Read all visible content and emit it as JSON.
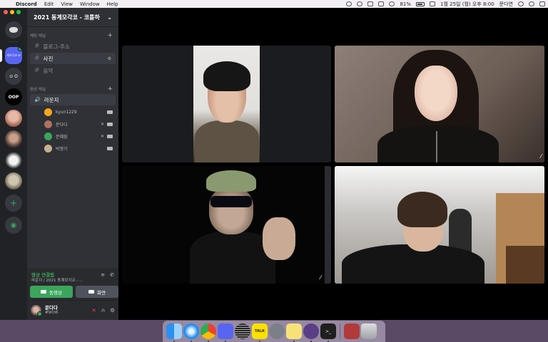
{
  "menubar": {
    "app_name": "Discord",
    "menus": [
      "Edit",
      "View",
      "Window",
      "Help"
    ],
    "battery": "81%",
    "datetime": "1월 25일 (월) 오후 8:00",
    "user": "문다연"
  },
  "guilds": {
    "active_label": "게모각코 코",
    "oop_label": "OOP",
    "double_o": "⊙ O"
  },
  "server": {
    "name": "2021 동계모각코 - 코틀하",
    "text_category": "채팅 채널",
    "voice_category": "음성 채널",
    "text_channels": [
      {
        "name": "블로그-주소",
        "selected": false
      },
      {
        "name": "사진",
        "selected": true
      },
      {
        "name": "음악",
        "selected": false
      }
    ],
    "voice_channel": "라운지",
    "voice_users": [
      {
        "name": "kyun1229",
        "color": "#faa61a"
      },
      {
        "name": "문다다",
        "color": "#b07060"
      },
      {
        "name": "문혜림",
        "color": "#3ba55c"
      },
      {
        "name": "박형기",
        "color": "#c8b090"
      }
    ]
  },
  "voice_panel": {
    "status": "영상 연결됨",
    "sub": "라운지 / 2021 동계모각코 - ...",
    "video_btn": "동영상",
    "screen_btn": "화면"
  },
  "user_panel": {
    "name": "문다다",
    "tag": "#9036"
  },
  "dock": {
    "talk_label": "TALK"
  },
  "colors": {
    "accent": "#5865f2",
    "online": "#3ba55c",
    "danger": "#ed4245"
  }
}
